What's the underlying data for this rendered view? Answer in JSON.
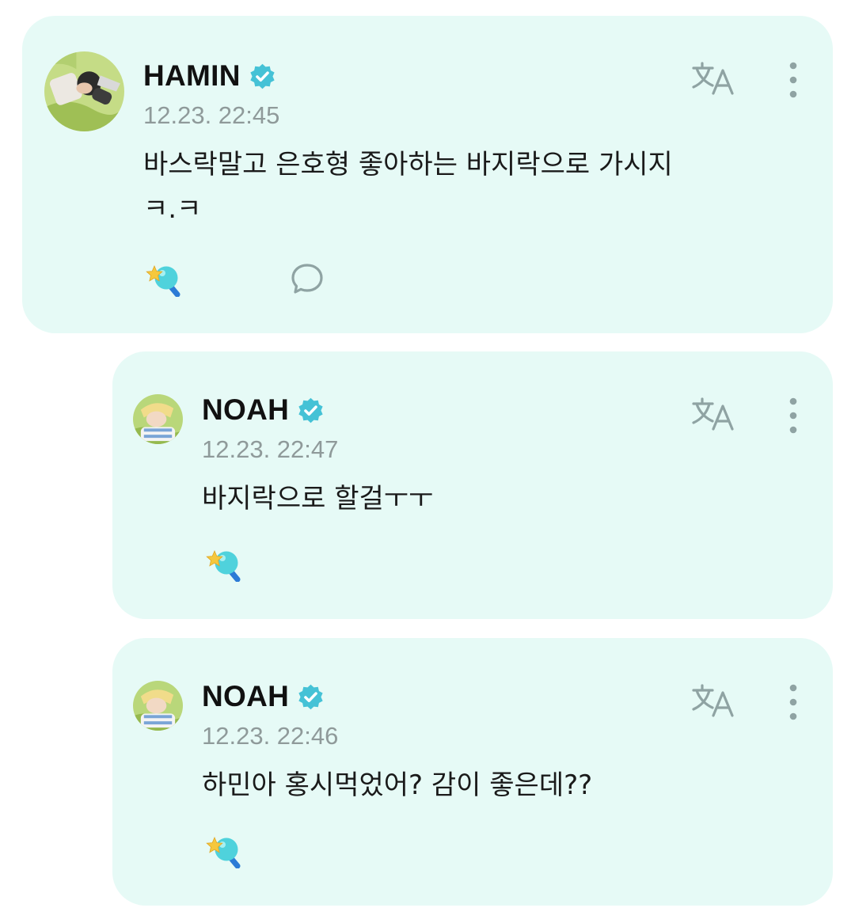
{
  "colors": {
    "card_background": "#e6faf6",
    "verified_badge": "#45c2d6",
    "icon_gray": "#8fa3a3",
    "timestamp": "#8f9a9a"
  },
  "comments": [
    {
      "author": "HAMIN",
      "verified": true,
      "timestamp": "12.23. 22:45",
      "text": "바스락말고 은호형 좋아하는 바지락으로 가시지\nㅋ.ㅋ",
      "icons": [
        "translate-icon",
        "more-icon",
        "reaction-icon",
        "comment-icon"
      ]
    },
    {
      "author": "NOAH",
      "verified": true,
      "timestamp": "12.23. 22:47",
      "text": "바지락으로 할걸ㅜㅜ",
      "icons": [
        "translate-icon",
        "more-icon",
        "reaction-icon"
      ]
    },
    {
      "author": "NOAH",
      "verified": true,
      "timestamp": "12.23. 22:46",
      "text": "하민아 홍시먹었어? 감이 좋은데??",
      "icons": [
        "translate-icon",
        "more-icon",
        "reaction-icon"
      ]
    }
  ]
}
